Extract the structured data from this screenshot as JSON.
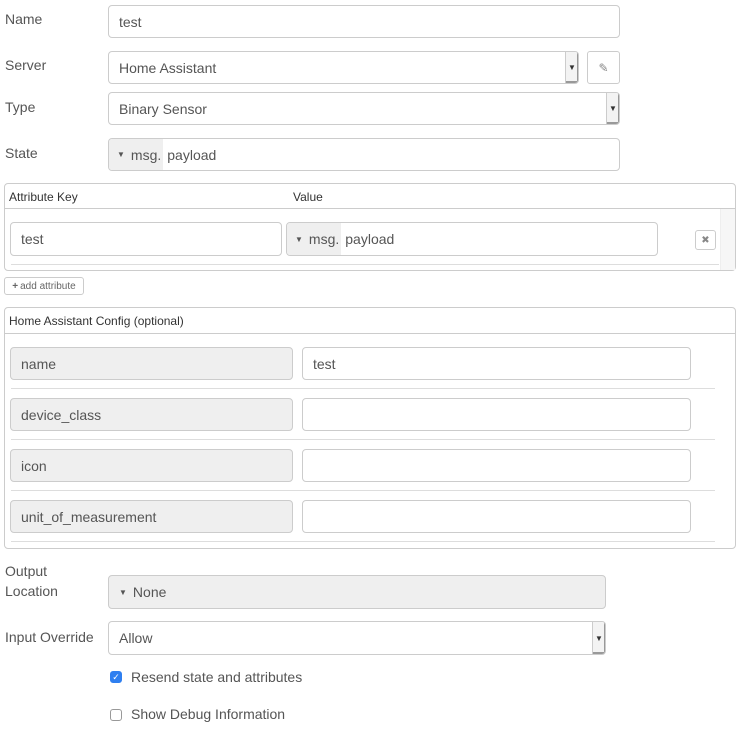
{
  "name": {
    "label": "Name",
    "value": "test"
  },
  "server": {
    "label": "Server",
    "value": "Home Assistant"
  },
  "type": {
    "label": "Type",
    "value": "Binary Sensor"
  },
  "state": {
    "label": "State",
    "type_prefix": "msg.",
    "value": "payload"
  },
  "attributes": {
    "key_header": "Attribute Key",
    "value_header": "Value",
    "rows": [
      {
        "key": "test",
        "type_prefix": "msg.",
        "value": "payload"
      }
    ],
    "add_label": "add attribute"
  },
  "ha_config": {
    "title": "Home Assistant Config (optional)",
    "rows": [
      {
        "key": "name",
        "value": "test"
      },
      {
        "key": "device_class",
        "value": ""
      },
      {
        "key": "icon",
        "value": ""
      },
      {
        "key": "unit_of_measurement",
        "value": ""
      }
    ]
  },
  "output_location": {
    "label_line1": "Output",
    "label_line2": "Location",
    "value": "None"
  },
  "input_override": {
    "label": "Input Override",
    "value": "Allow"
  },
  "resend": {
    "label": "Resend state and attributes",
    "checked": true
  },
  "debug": {
    "label": "Show Debug Information",
    "checked": false
  }
}
